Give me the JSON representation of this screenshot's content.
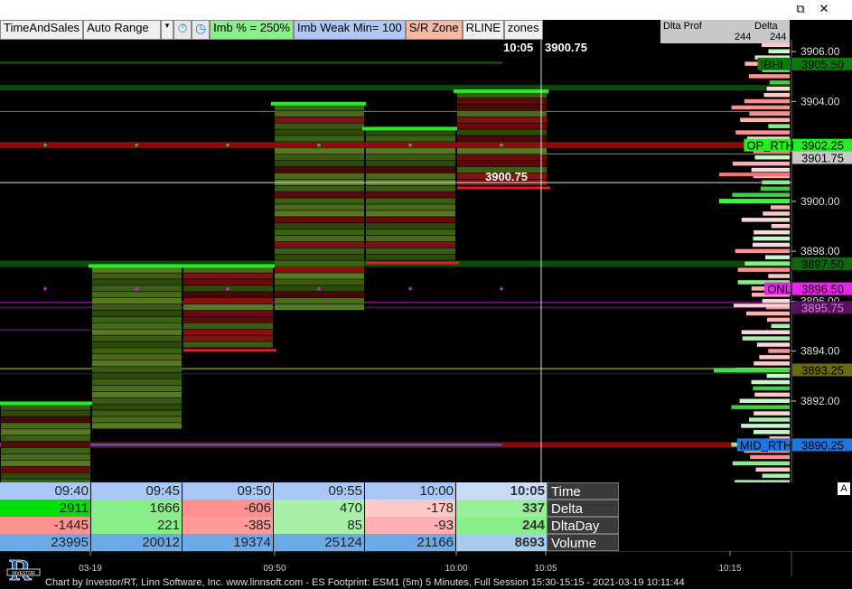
{
  "window": {
    "restore_glyph": "⧉",
    "close_glyph": "✕"
  },
  "toolbar": {
    "time_and_sales": "TimeAndSales",
    "range_mode": "Auto Range",
    "dropdown_arrow": "▾",
    "imb_pct": "Imb % = 250%",
    "imb_weak": "Imb Weak Min= 100",
    "sr_zone": "S/R Zone",
    "rline": "RLINE",
    "zones": "zones",
    "icon_timer": "stopwatch-icon",
    "icon_clock": "clock-icon"
  },
  "delta_profile": {
    "title": "Dlta Prof",
    "col_title": "Delta",
    "value1": "244",
    "value2": "244"
  },
  "cursor": {
    "time": "10:05",
    "price": "3900.75",
    "label": "3900.75"
  },
  "price_axis": {
    "ticks": [
      "3906.00",
      "3904.00",
      "3902.00",
      "3900.00",
      "3898.00",
      "3896.00",
      "3894.00",
      "3892.00"
    ],
    "last_price": "3901.75"
  },
  "levels": [
    {
      "name": "IBHI",
      "price": "3905.50",
      "color": "#0a7a0a",
      "price_color": "#0a7a0a",
      "text_color": "#000"
    },
    {
      "name": "OP_RTH",
      "price": "3902.25",
      "color": "#22ee22",
      "price_color": "#22ee22",
      "text_color": "#000"
    },
    {
      "name": "",
      "price": "3897.50",
      "color": "#0a6a0a",
      "price_color": "#0a6a0a",
      "text_color": "#000"
    },
    {
      "name": "ONL",
      "price": "3896.50",
      "color": "#ee22ee",
      "price_color": "#ee22ee",
      "text_color": "#000"
    },
    {
      "name": "",
      "price": "3895.75",
      "color": "#5a1060",
      "price_color": "#5a1060",
      "text_color": "#cc88cc"
    },
    {
      "name": "",
      "price": "3893.25",
      "color": "#6a6a10",
      "price_color": "#6a6a10",
      "text_color": "#000"
    },
    {
      "name": "MID_RTH",
      "price": "3890.25",
      "color": "#1a78e0",
      "price_color": "#1a78e0",
      "text_color": "#000"
    }
  ],
  "time_axis": [
    "03-19",
    "09:50",
    "10:00",
    "10:05",
    "10:15"
  ],
  "table": {
    "labels": [
      "Time",
      "Delta",
      "DltaDay",
      "Volume"
    ],
    "time": [
      "09:40",
      "09:45",
      "09:50",
      "09:55",
      "10:00",
      "10:05"
    ],
    "delta": [
      "2911",
      "1666",
      "-606",
      "470",
      "-178",
      "337"
    ],
    "dltaday": [
      "-1445",
      "221",
      "-385",
      "85",
      "-93",
      "244"
    ],
    "volume": [
      "23995",
      "20012",
      "19374",
      "25124",
      "21166",
      "8693"
    ],
    "delta_colors": [
      "#00e000",
      "#88ee88",
      "#ff9090",
      "#a8f0a8",
      "#ffc8c8",
      "#99ee99"
    ],
    "dltaday_colors": [
      "#ff9090",
      "#88ee88",
      "#ff9a9a",
      "#a8f0a8",
      "#ffb0b0",
      "#88ee88"
    ],
    "time_color": "#a8c8f8",
    "volume_color": "#6aaae8",
    "a_button": "A"
  },
  "footer": "Chart by Investor/RT, Linn Software, Inc. www.linnsoft.com - ES Footprint: ESM1 (5m) 5 Minutes, Full Session 15:30-15:15 - 2021-03-19 10:11:44",
  "logo_text": "INVESTOR"
}
